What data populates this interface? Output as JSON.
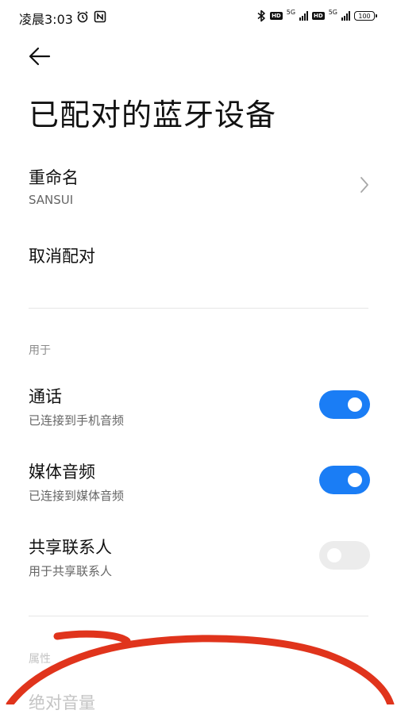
{
  "status_bar": {
    "time": "凌晨3:03",
    "battery": "100",
    "network_1": "5G",
    "network_2": "5G",
    "hd_badge": "HD"
  },
  "header": {
    "title": "已配对的蓝牙设备"
  },
  "device": {
    "rename_label": "重命名",
    "device_name": "SANSUI",
    "unpair_label": "取消配对"
  },
  "usage": {
    "section_label": "用于",
    "items": [
      {
        "title": "通话",
        "subtitle": "已连接到手机音频",
        "enabled": true
      },
      {
        "title": "媒体音频",
        "subtitle": "已连接到媒体音频",
        "enabled": true
      },
      {
        "title": "共享联系人",
        "subtitle": "用于共享联系人",
        "enabled": false
      }
    ]
  },
  "properties": {
    "section_label": "属性",
    "absolute_volume_label": "绝对音量"
  },
  "colors": {
    "toggle_on": "#1a7df5",
    "toggle_off": "#ececec",
    "annotation_stroke": "#e0341c"
  },
  "icons": {
    "back": "arrow-left-icon",
    "chevron": "chevron-right-icon",
    "bluetooth": "bluetooth-icon",
    "alarm": "alarm-icon",
    "nfc": "nfc-icon"
  }
}
